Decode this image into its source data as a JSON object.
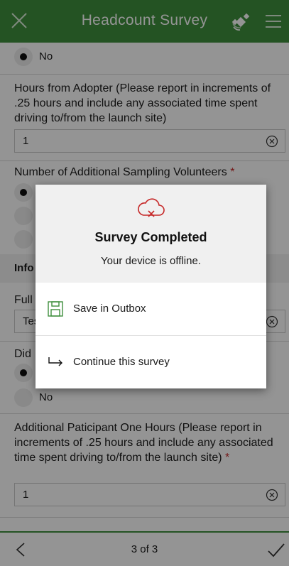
{
  "header": {
    "title": "Headcount Survey",
    "close_icon": "close-icon",
    "location_icon": "satellite-icon",
    "menu_icon": "hamburger-menu-icon",
    "color": "#3f8f3d"
  },
  "form": {
    "prev_radio": {
      "label": "No",
      "selected": true
    },
    "hours_adopter": {
      "question": "Hours from Adopter (Please report in increments of .25 hours and include any associated time spent driving to/from the launch site)",
      "value": "1"
    },
    "additional_volunteers": {
      "question": "Number of Additional Sampling Volunteers",
      "required_mark": "*"
    },
    "info_section": {
      "label": "Info"
    },
    "full_field": {
      "label": "Full",
      "value": "Tes"
    },
    "did_question": {
      "label": "Did"
    },
    "did_option_no": {
      "label": "No",
      "selected": false
    },
    "additional_participant_hours": {
      "question": "Additional Paticipant One Hours (Please report in increments of .25 hours and include any associated time spent driving to/from the launch site)",
      "required_mark": "*",
      "value": "1"
    }
  },
  "dialog": {
    "title": "Survey Completed",
    "message": "Your device is offline.",
    "icon": "cloud-offline-icon",
    "options": [
      {
        "label": "Save in Outbox",
        "icon": "save-icon"
      },
      {
        "label": "Continue this survey",
        "icon": "arrow-return-icon"
      }
    ]
  },
  "footer": {
    "page_indicator": "3 of 3",
    "back_icon": "chevron-left-icon",
    "submit_icon": "checkmark-icon"
  }
}
